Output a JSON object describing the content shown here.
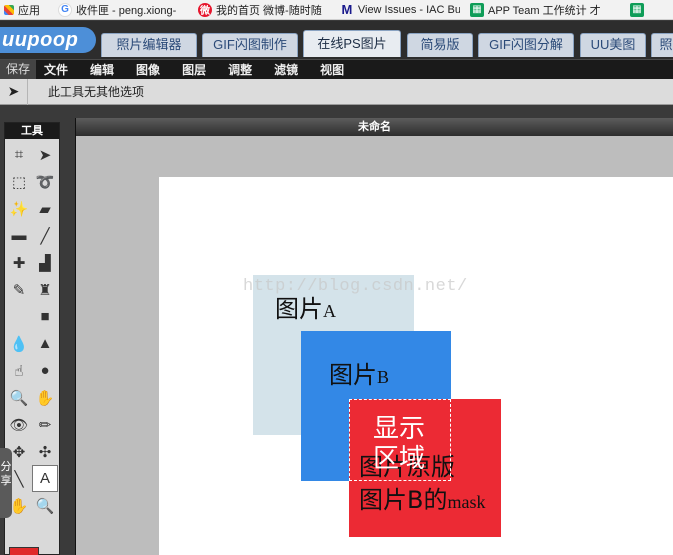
{
  "bookmarks": [
    {
      "icon": "apps-icon",
      "label": "应用"
    },
    {
      "icon": "google-icon",
      "label": "收件匣 - peng.xiong-"
    },
    {
      "icon": "weibo-icon",
      "label": "我的首页 微博-随时随"
    },
    {
      "icon": "m-icon",
      "label": "View Issues - IAC Bu"
    },
    {
      "icon": "sheet-icon",
      "label": "APP Team 工作统计 才"
    },
    {
      "icon": "sheet-icon",
      "label": ""
    }
  ],
  "logo": "uupoop",
  "tabs": [
    {
      "label": "照片编辑器",
      "active": false
    },
    {
      "label": "GIF闪图制作",
      "active": false
    },
    {
      "label": "在线PS图片",
      "active": true
    },
    {
      "label": "简易版",
      "active": false
    },
    {
      "label": "GIF闪图分解",
      "active": false
    },
    {
      "label": "UU美图",
      "active": false
    },
    {
      "label": "照",
      "active": false
    }
  ],
  "menu": {
    "save": "保存",
    "items": [
      "文件",
      "编辑",
      "图像",
      "图层",
      "调整",
      "滤镜",
      "视图"
    ]
  },
  "options": {
    "message": "此工具无其他选项"
  },
  "tools_panel": {
    "title": "工具",
    "tools": [
      {
        "icon": "crop-icon",
        "glyph": "⌗"
      },
      {
        "icon": "move-icon",
        "glyph": "➤"
      },
      {
        "icon": "marquee-icon",
        "glyph": "⬚"
      },
      {
        "icon": "lasso-icon",
        "glyph": "➰"
      },
      {
        "icon": "magic-wand-icon",
        "glyph": "✨"
      },
      {
        "icon": "eraser-icon",
        "glyph": "▰"
      },
      {
        "icon": "gradient-icon",
        "glyph": "▬"
      },
      {
        "icon": "brush-icon",
        "glyph": "╱"
      },
      {
        "icon": "spot-heal-icon",
        "glyph": "✚"
      },
      {
        "icon": "paint-bucket-icon",
        "glyph": "▟"
      },
      {
        "icon": "pencil-icon",
        "glyph": "✎"
      },
      {
        "icon": "stamp-icon",
        "glyph": "♜"
      },
      {
        "icon": "blank-icon",
        "glyph": ""
      },
      {
        "icon": "shape-icon",
        "glyph": "■"
      },
      {
        "icon": "drop-icon",
        "glyph": "💧"
      },
      {
        "icon": "sharpen-icon",
        "glyph": "▲"
      },
      {
        "icon": "smudge-icon",
        "glyph": "☝"
      },
      {
        "icon": "sponge-icon",
        "glyph": "●"
      },
      {
        "icon": "zoom-tool-icon",
        "glyph": "🔍"
      },
      {
        "icon": "dodge-icon",
        "glyph": "✋"
      },
      {
        "icon": "red-eye-icon",
        "glyph": "👁"
      },
      {
        "icon": "burn-icon",
        "glyph": "✏"
      },
      {
        "icon": "bloat-icon",
        "glyph": "✥"
      },
      {
        "icon": "pinch-icon",
        "glyph": "✣"
      },
      {
        "icon": "line-icon",
        "glyph": "╲"
      },
      {
        "icon": "text-tool-icon",
        "glyph": "A"
      },
      {
        "icon": "hand-icon",
        "glyph": "✋"
      },
      {
        "icon": "zoom-icon",
        "glyph": "🔍"
      }
    ],
    "color": "#e02a2a",
    "share_label": "分享"
  },
  "document": {
    "title": "未命名",
    "watermark": "http://blog.csdn.net/",
    "layer_a": {
      "label": "图片",
      "suffix": "A",
      "color": "#d4e3ea"
    },
    "layer_b": {
      "label": "图片",
      "suffix": "B",
      "color": "#3388e6"
    },
    "layer_mask": {
      "line1": "图片原版",
      "line2_main": "图片B的",
      "line2_suffix": "mask",
      "color": "#ec2a34"
    },
    "display_area": {
      "line1": "显示",
      "line2": "区域"
    }
  }
}
